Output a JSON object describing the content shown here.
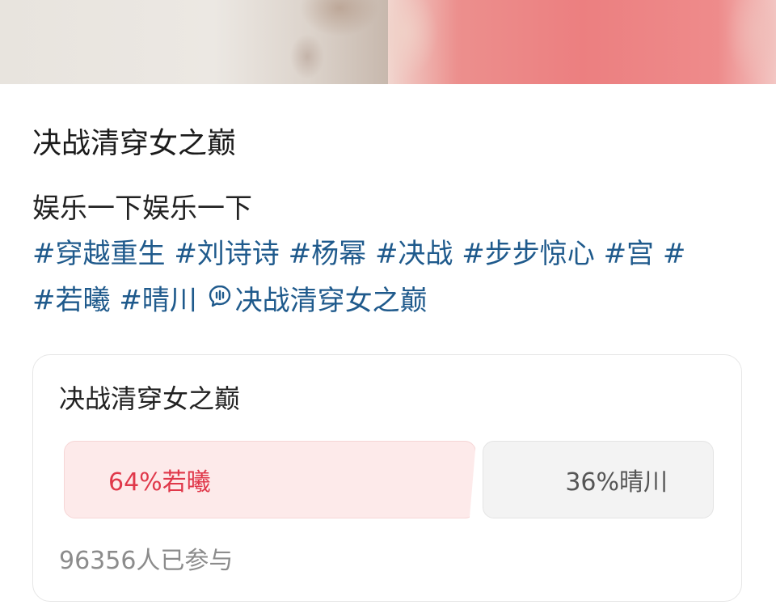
{
  "post": {
    "title": "决战清穿女之巅",
    "text": "娱乐一下娱乐一下",
    "hashtags": [
      "#穿越重生",
      "#刘诗诗",
      "#杨幂",
      "#决战",
      "#步步惊心",
      "#宫",
      "#若曦",
      "#晴川"
    ],
    "topic": "决战清穿女之巅",
    "topic_icon": "chat-bubble-icon",
    "link_color": "#1f5a8c"
  },
  "poll": {
    "title": "决战清穿女之巅",
    "options": [
      {
        "label": "64%若曦",
        "percent": 64,
        "color": "#e0384a"
      },
      {
        "label": "36%晴川",
        "percent": 36,
        "color": "#555555"
      }
    ],
    "participants": "96356人已参与"
  }
}
